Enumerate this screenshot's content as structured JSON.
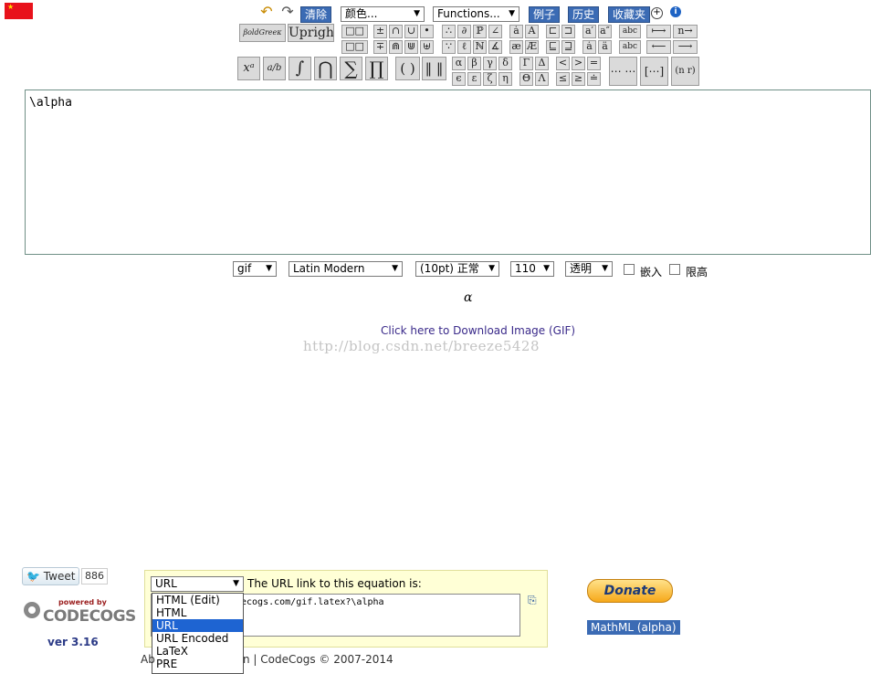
{
  "toolbar": {
    "undo_icon": "undo-icon",
    "redo_icon": "redo-icon",
    "clear": "清除",
    "color_select": "颜色...",
    "functions_select": "Functions...",
    "examples": "例子",
    "history": "历史",
    "favorites": "收藏夹",
    "bold_green": "βoldGreeκ",
    "upright": "Upright"
  },
  "symbols": {
    "row1": [
      "□□",
      "±",
      "∩",
      "∪",
      "•",
      "∴",
      "∂",
      "ℙ",
      "∠",
      "ȧ",
      "Ȧ",
      "⊏",
      "⊐",
      "a′",
      "a″",
      "abc",
      "⟼",
      "n→"
    ],
    "row2": [
      "□□",
      "∓",
      "⋒",
      "⋓",
      "⊎",
      "∵",
      "ℓ",
      "ℕ",
      "∡",
      "æ",
      "Æ",
      "⊑",
      "⊒",
      "ȧ",
      "ä",
      "abc",
      "⟵",
      "⟶"
    ],
    "big": [
      "xᵃ",
      "a/b",
      "∫",
      "⋂",
      "∑",
      "∏",
      "( )",
      "‖ ‖"
    ],
    "greek1": [
      "α",
      "β",
      "γ",
      "δ"
    ],
    "greek2": [
      "ϵ",
      "ε",
      "ζ",
      "η"
    ],
    "ugreek1": [
      "Γ",
      "Δ"
    ],
    "ugreek2": [
      "Θ",
      "Λ"
    ],
    "rel1": [
      "<",
      ">",
      "="
    ],
    "rel2": [
      "≤",
      "≥",
      "≐"
    ],
    "matrices": [
      "⋯ ⋯",
      "[⋯]",
      "(n r)"
    ]
  },
  "editor": {
    "value": "\\alpha"
  },
  "options": {
    "format": "gif",
    "font": "Latin Modern",
    "size": "(10pt) 正常",
    "dpi": "110",
    "background": "透明",
    "embed_label": "嵌入",
    "limit_label": "限高"
  },
  "preview": {
    "rendered": "α",
    "download": "Click here to Download Image (GIF)",
    "watermark": "http://blog.csdn.net/breeze5428"
  },
  "social": {
    "tweet": "Tweet",
    "count": "886",
    "powered_by": "powered by",
    "brand": "CODECOGS",
    "version": "ver 3.16"
  },
  "link_panel": {
    "selected": "URL",
    "caption": "The URL link to this equation is:",
    "value": "ecogs.com/gif.latex?\\alpha",
    "options": [
      "HTML (Edit)",
      "HTML",
      "URL",
      "URL Encoded",
      "LaTeX",
      "PRE"
    ]
  },
  "right": {
    "donate": "Donate",
    "mathml": "MathML (alpha)"
  },
  "footer": {
    "left": "Ab",
    "right": "n | CodeCogs © 2007-2014"
  }
}
